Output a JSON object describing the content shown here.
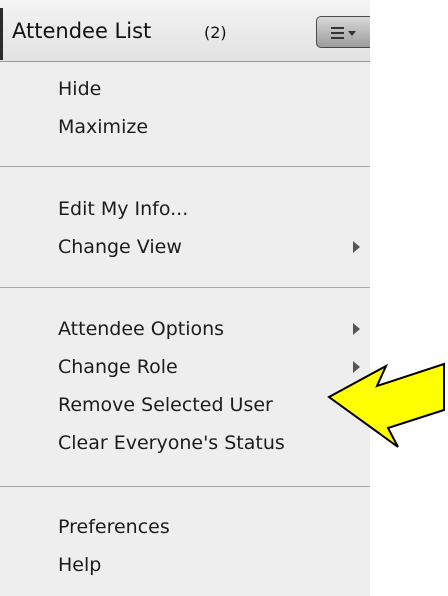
{
  "header": {
    "title": "Attendee List",
    "count": "(2)"
  },
  "menu": {
    "group1": [
      "Hide",
      "Maximize"
    ],
    "group2": [
      "Edit My Info...",
      "Change View"
    ],
    "group3": [
      "Attendee Options",
      "Change Role",
      "Remove Selected User",
      "Clear Everyone's Status"
    ],
    "group4": [
      "Preferences",
      "Help"
    ]
  },
  "icons": {
    "menu_button": "menu-lines-icon",
    "submenu": "chevron-right-icon",
    "callout": "arrow-left-icon"
  },
  "colors": {
    "panel_bg": "#eeeeee",
    "separator": "#a8a8a8",
    "callout_fill": "#ffff00",
    "callout_stroke": "#000000"
  }
}
